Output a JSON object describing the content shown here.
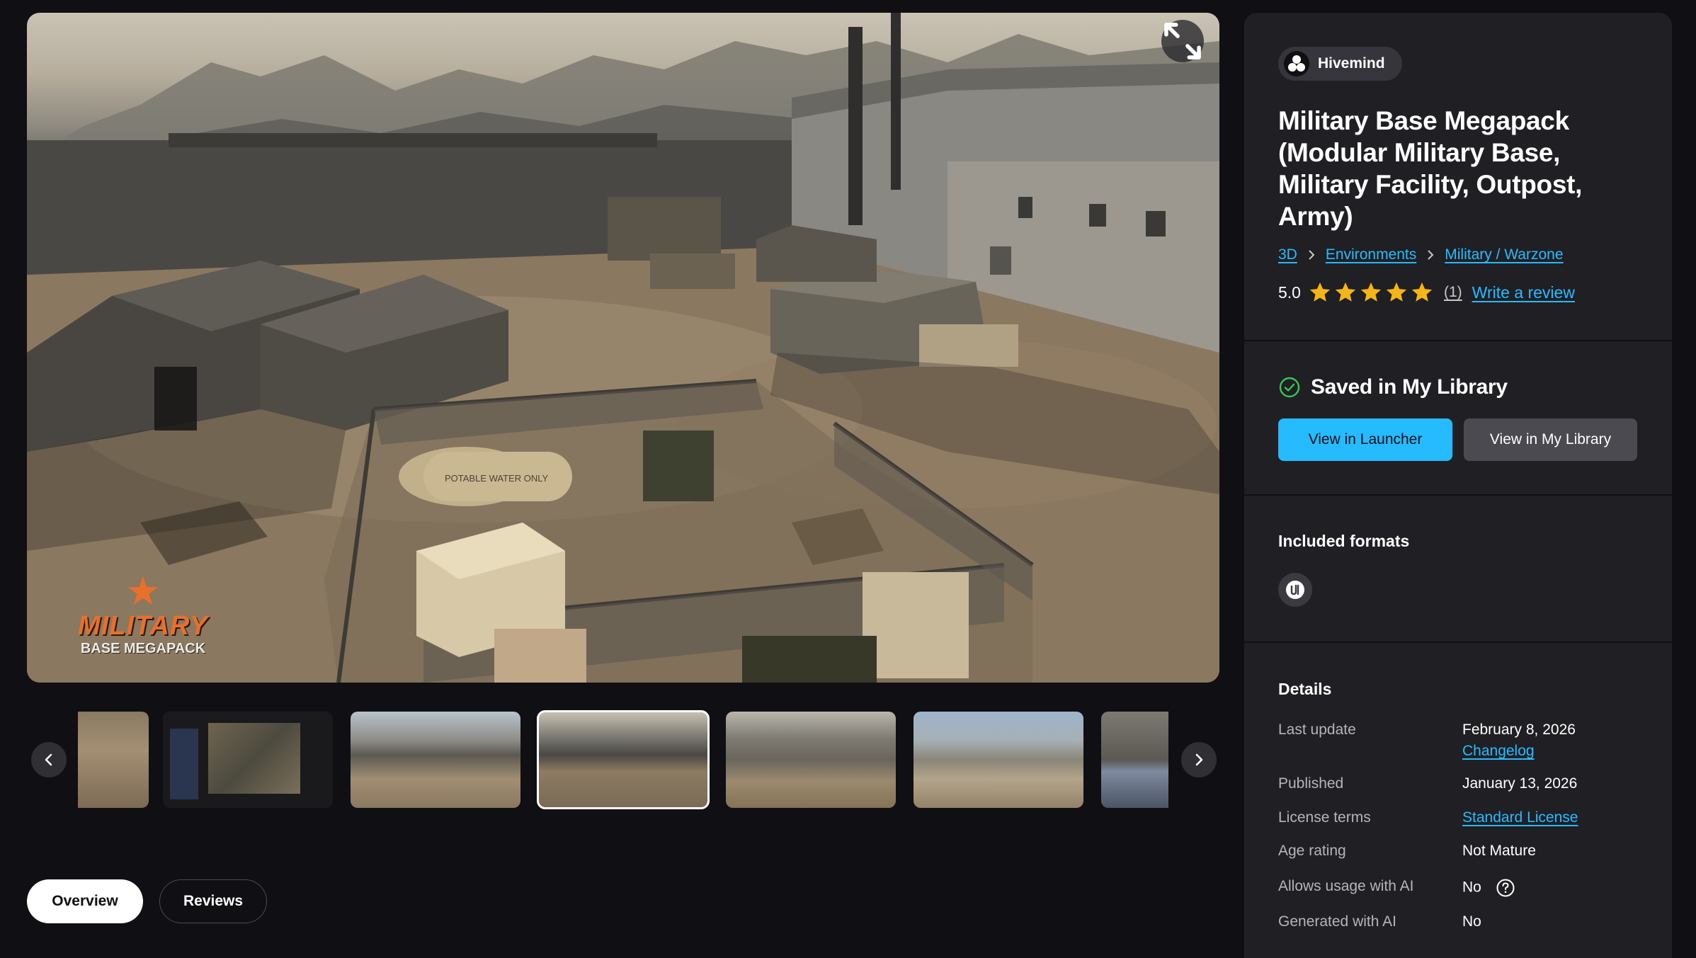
{
  "hero": {
    "logo_top": "MILITARY",
    "logo_bottom": "BASE MEGAPACK",
    "tank_text": "POTABLE WATER ONLY"
  },
  "tabs": [
    {
      "label": "Overview",
      "active": true
    },
    {
      "label": "Reviews",
      "active": false
    }
  ],
  "thumbnails": {
    "count_visible": 7,
    "active_index": 3
  },
  "product": {
    "seller": "Hivemind",
    "title": "Military Base Megapack (Modular Military Base, Military Facility, Outpost, Army)",
    "breadcrumb": [
      "3D",
      "Environments",
      "Military / Warzone"
    ],
    "rating": "5.0",
    "stars": 5,
    "rating_count": "(1)",
    "write_review": "Write a review"
  },
  "library": {
    "status": "Saved in My Library",
    "primary_button": "View in Launcher",
    "secondary_button": "View in My Library"
  },
  "formats": {
    "title": "Included formats",
    "items": [
      "unreal-engine-icon"
    ]
  },
  "details": {
    "title": "Details",
    "last_update_label": "Last update",
    "last_update_value": "February 8, 2026",
    "changelog": "Changelog",
    "published_label": "Published",
    "published_value": "January 13, 2026",
    "license_label": "License terms",
    "license_value": "Standard License",
    "age_label": "Age rating",
    "age_value": "Not Mature",
    "ai_usage_label": "Allows usage with AI",
    "ai_usage_value": "No",
    "ai_generated_label": "Generated with AI",
    "ai_generated_value": "No"
  },
  "colors": {
    "background": "#101014",
    "panel": "#202024",
    "accent": "#26bbff",
    "star": "#f5b418",
    "success": "#34c759"
  }
}
